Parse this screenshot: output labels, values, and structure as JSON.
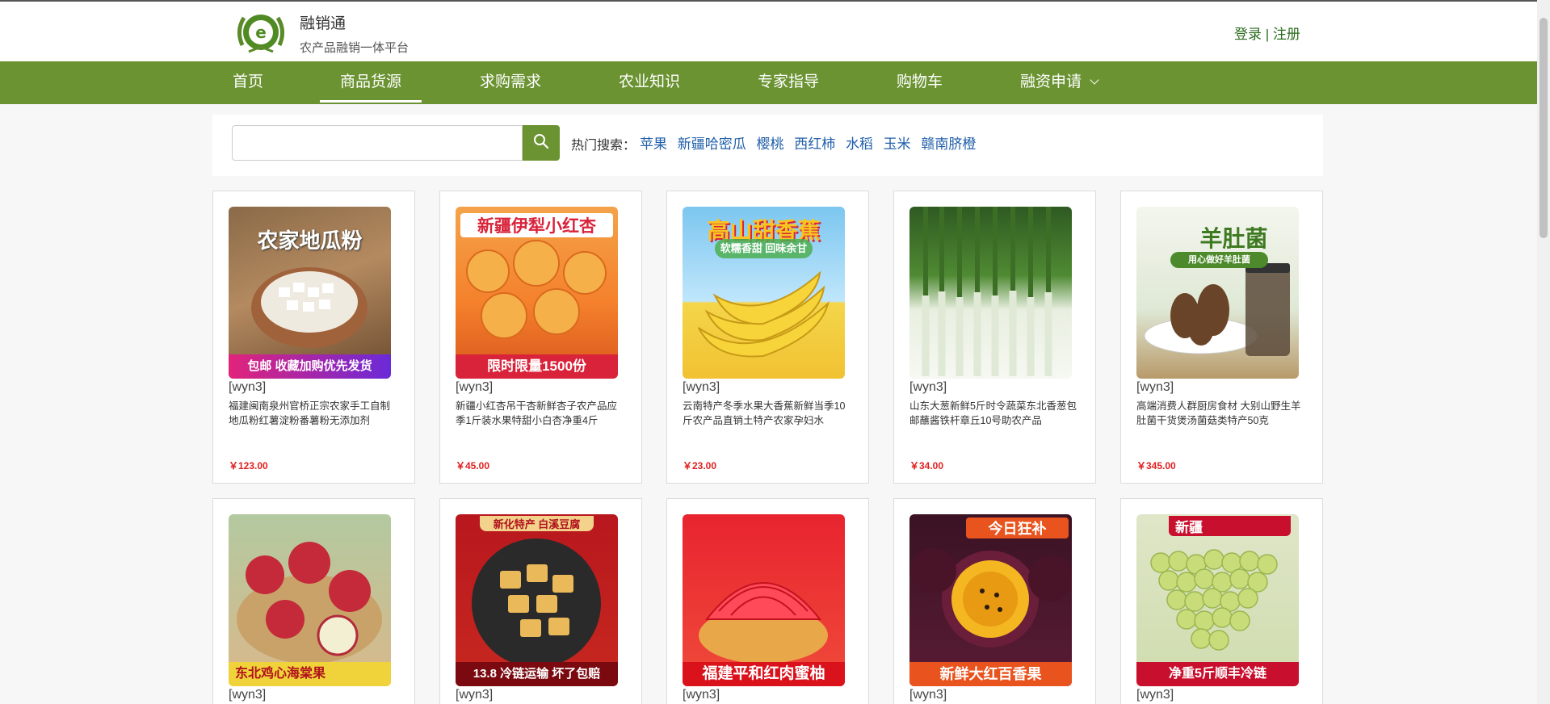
{
  "header": {
    "brand_name": "融销通",
    "brand_sub": "农产品融销一体平台",
    "login": "登录",
    "separator": " | ",
    "register": "注册"
  },
  "nav": {
    "items": [
      {
        "label": "首页"
      },
      {
        "label": "商品货源"
      },
      {
        "label": "求购需求"
      },
      {
        "label": "农业知识"
      },
      {
        "label": "专家指导"
      },
      {
        "label": "购物车"
      },
      {
        "label": "融资申请"
      }
    ],
    "active": "商品货源"
  },
  "search": {
    "placeholder": "",
    "hot_label": "热门搜索：",
    "hot_links": [
      "苹果",
      "新疆哈密瓜",
      "樱桃",
      "西红柿",
      "水稻",
      "玉米",
      "赣南脐橙"
    ]
  },
  "products": [
    {
      "seller": "[wyn3]",
      "name": "福建闽南泉州官桥正宗农家手工自制地瓜粉红薯淀粉番薯粉无添加剂",
      "price": "￥123.00",
      "img_title": "农家地瓜粉",
      "img_banner": "包邮 收藏加购优先发货"
    },
    {
      "seller": "[wyn3]",
      "name": "新疆小红杏吊干杏新鲜杏子农产品应季1斤装水果特甜小白杏净重4斤",
      "price": "￥45.00",
      "img_title": "新疆伊犁小红杏",
      "img_banner": "限时限量1500份"
    },
    {
      "seller": "[wyn3]",
      "name": "云南特产冬季水果大香蕉新鲜当季10斤农产品直销土特产农家孕妇水",
      "price": "￥23.00",
      "img_title": "高山甜香蕉",
      "img_banner": "软糯香甜 回味余甘"
    },
    {
      "seller": "[wyn3]",
      "name": "山东大葱新鲜5斤时令蔬菜东北香葱包邮蘸酱铁杆章丘10号助农产品",
      "price": "￥34.00",
      "img_title": "",
      "img_banner": ""
    },
    {
      "seller": "[wyn3]",
      "name": "高端消费人群厨房食材 大别山野生羊肚菌干货煲汤菌菇类特产50克",
      "price": "￥345.00",
      "img_title": "羊肚菌",
      "img_banner": "用心做好羊肚菌"
    },
    {
      "seller": "[wyn3]",
      "name": "",
      "price": "",
      "img_title": "",
      "img_banner": "东北鸡心海棠果"
    },
    {
      "seller": "[wyn3]",
      "name": "",
      "price": "",
      "img_title": "新化特产 白溪豆腐",
      "img_banner": "13.8 冷链运输 坏了包赔"
    },
    {
      "seller": "[wyn3]",
      "name": "",
      "price": "",
      "img_title": "",
      "img_banner": "福建平和红肉蜜柚"
    },
    {
      "seller": "[wyn3]",
      "name": "",
      "price": "",
      "img_title": "今日狂补",
      "img_banner": "新鲜大红百香果"
    },
    {
      "seller": "[wyn3]",
      "name": "",
      "price": "",
      "img_title": "新疆",
      "img_banner": "净重5斤顺丰冷链"
    }
  ],
  "colors": {
    "nav_green": "#6b9332",
    "link_blue": "#1f5ea8",
    "price_red": "#e02020",
    "auth_green": "#2b6b1e"
  }
}
